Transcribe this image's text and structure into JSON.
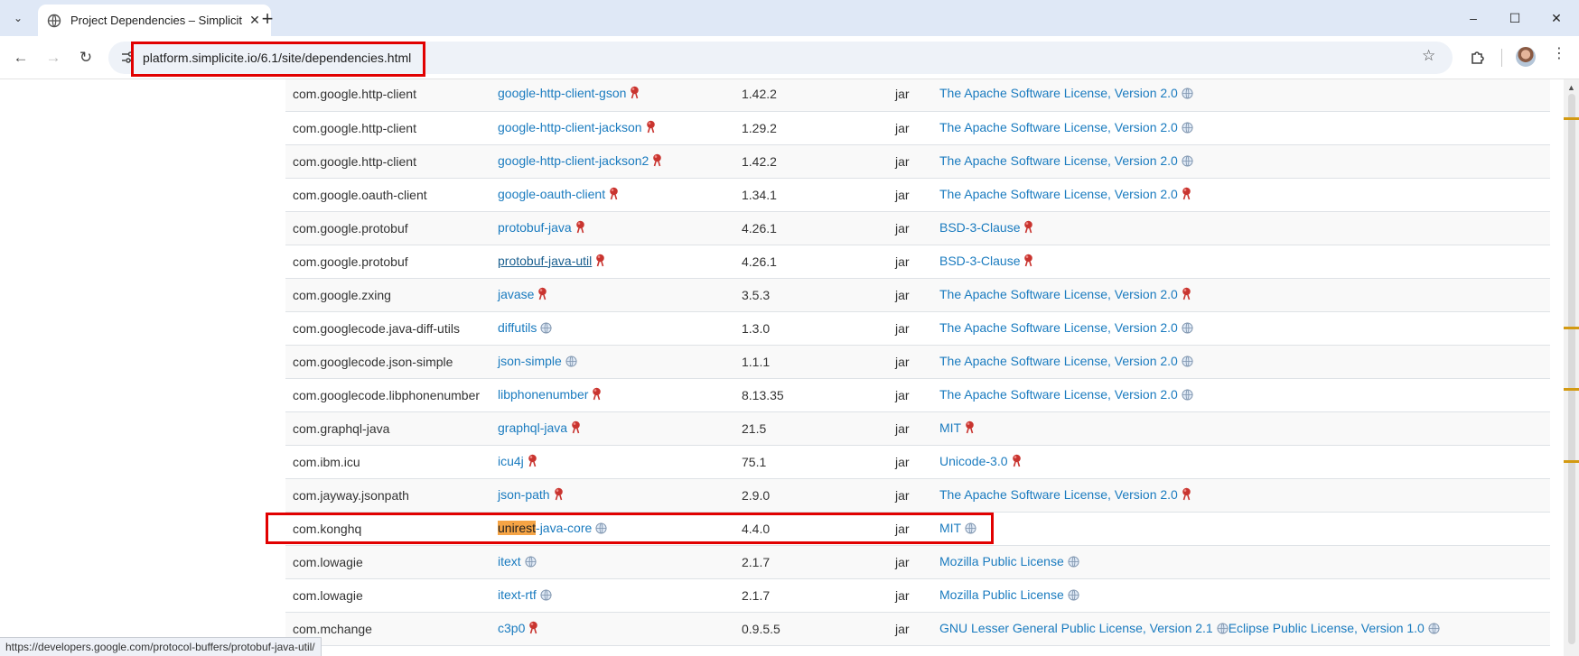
{
  "browser": {
    "tab": {
      "title": "Project Dependencies – Simplicité",
      "close_icon": "close-icon"
    },
    "window_controls": {
      "minimize": "–",
      "maximize": "☐",
      "close": "✕"
    },
    "url": "platform.simplicite.io/6.1/site/dependencies.html",
    "status_url": "https://developers.google.com/protocol-buffers/protobuf-java-util/"
  },
  "dependencies": [
    {
      "group": "com.google.http-client",
      "artifact": "google-http-client-gson",
      "artifact_icon": "external",
      "version": "1.42.2",
      "type": "jar",
      "license": "The Apache Software License, Version 2.0",
      "license_icon": "globe"
    },
    {
      "group": "com.google.http-client",
      "artifact": "google-http-client-jackson",
      "artifact_icon": "external",
      "version": "1.29.2",
      "type": "jar",
      "license": "The Apache Software License, Version 2.0",
      "license_icon": "globe"
    },
    {
      "group": "com.google.http-client",
      "artifact": "google-http-client-jackson2",
      "artifact_icon": "external",
      "version": "1.42.2",
      "type": "jar",
      "license": "The Apache Software License, Version 2.0",
      "license_icon": "globe"
    },
    {
      "group": "com.google.oauth-client",
      "artifact": "google-oauth-client",
      "artifact_icon": "external",
      "version": "1.34.1",
      "type": "jar",
      "license": "The Apache Software License, Version 2.0",
      "license_icon": "external"
    },
    {
      "group": "com.google.protobuf",
      "artifact": "protobuf-java",
      "artifact_icon": "external",
      "version": "4.26.1",
      "type": "jar",
      "license": "BSD-3-Clause",
      "license_icon": "external"
    },
    {
      "group": "com.google.protobuf",
      "artifact": "protobuf-java-util",
      "artifact_icon": "external",
      "version": "4.26.1",
      "type": "jar",
      "license": "BSD-3-Clause",
      "license_icon": "external",
      "hovered": true
    },
    {
      "group": "com.google.zxing",
      "artifact": "javase",
      "artifact_icon": "external",
      "version": "3.5.3",
      "type": "jar",
      "license": "The Apache Software License, Version 2.0",
      "license_icon": "external"
    },
    {
      "group": "com.googlecode.java-diff-utils",
      "artifact": "diffutils",
      "artifact_icon": "globe",
      "version": "1.3.0",
      "type": "jar",
      "license": "The Apache Software License, Version 2.0",
      "license_icon": "globe"
    },
    {
      "group": "com.googlecode.json-simple",
      "artifact": "json-simple",
      "artifact_icon": "globe",
      "version": "1.1.1",
      "type": "jar",
      "license": "The Apache Software License, Version 2.0",
      "license_icon": "globe"
    },
    {
      "group": "com.googlecode.libphonenumber",
      "artifact": "libphonenumber",
      "artifact_icon": "external",
      "version": "8.13.35",
      "type": "jar",
      "license": "The Apache Software License, Version 2.0",
      "license_icon": "globe"
    },
    {
      "group": "com.graphql-java",
      "artifact": "graphql-java",
      "artifact_icon": "external",
      "version": "21.5",
      "type": "jar",
      "license": "MIT",
      "license_icon": "external"
    },
    {
      "group": "com.ibm.icu",
      "artifact": "icu4j",
      "artifact_icon": "external",
      "version": "75.1",
      "type": "jar",
      "license": "Unicode-3.0",
      "license_icon": "external"
    },
    {
      "group": "com.jayway.jsonpath",
      "artifact": "json-path",
      "artifact_icon": "external",
      "version": "2.9.0",
      "type": "jar",
      "license": "The Apache Software License, Version 2.0",
      "license_icon": "external"
    },
    {
      "group": "com.konghq",
      "artifact": "unirest-java-core",
      "artifact_highlight": "unirest",
      "artifact_rest": "-java-core",
      "artifact_icon": "globe",
      "version": "4.4.0",
      "type": "jar",
      "license": "MIT",
      "license_icon": "globe"
    },
    {
      "group": "com.lowagie",
      "artifact": "itext",
      "artifact_icon": "globe",
      "version": "2.1.7",
      "type": "jar",
      "license": "Mozilla Public License",
      "license_icon": "globe"
    },
    {
      "group": "com.lowagie",
      "artifact": "itext-rtf",
      "artifact_icon": "globe",
      "version": "2.1.7",
      "type": "jar",
      "license": "Mozilla Public License",
      "license_icon": "globe"
    },
    {
      "group": "com.mchange",
      "artifact": "c3p0",
      "artifact_icon": "external",
      "version": "0.9.5.5",
      "type": "jar",
      "license": "GNU Lesser General Public License, Version 2.1",
      "license_icon": "globe",
      "license2": "Eclipse Public License, Version 1.0",
      "license2_icon": "globe"
    }
  ],
  "colors": {
    "link": "#1a7bbf",
    "highlight": "#f5a445",
    "annotation_box": "#e10000",
    "scroll_marker": "#d39a12"
  }
}
